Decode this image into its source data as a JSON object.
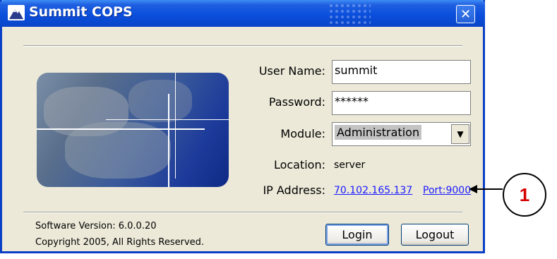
{
  "window": {
    "title": "Summit COPS",
    "close_label": "✕"
  },
  "form": {
    "username_label": "User Name:",
    "username_value": "summit",
    "password_label": "Password:",
    "password_value": "******",
    "module_label": "Module:",
    "module_value": "Administration",
    "module_dropdown_icon": "▼",
    "location_label": "Location:",
    "location_value": "server",
    "ip_label": "IP Address:",
    "ip_value": "70.102.165.137",
    "port_value": "Port:9000"
  },
  "footer": {
    "version": "Software Version: 6.0.0.20",
    "copyright": "Copyright 2005, All Rights Reserved."
  },
  "buttons": {
    "login": "Login",
    "logout": "Logout"
  },
  "callout": {
    "number": "1"
  },
  "icons": {
    "app_icon": "mountain-icon",
    "dropdown_icon": "chevron-down-icon"
  },
  "colors": {
    "titlebar": "#0b4fdc",
    "window_border": "#0a3fc6",
    "window_bg": "#ece9d8",
    "link": "#1a1aff",
    "callout_text": "#d40000"
  }
}
